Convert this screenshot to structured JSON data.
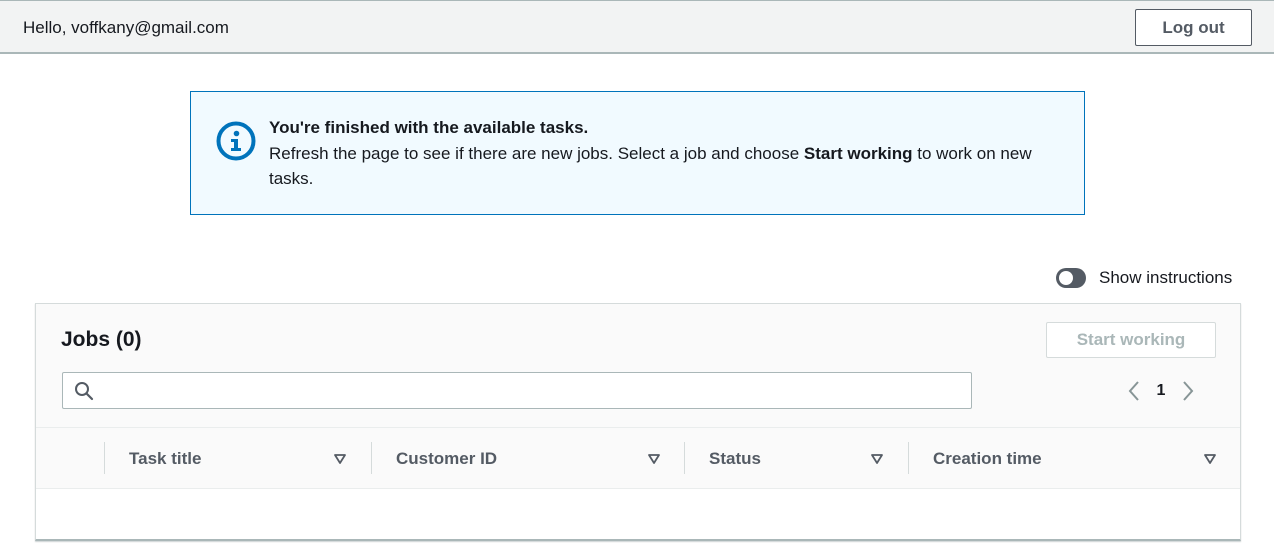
{
  "header": {
    "greeting": "Hello, voffkany@gmail.com",
    "logout_label": "Log out"
  },
  "alert": {
    "icon": "info-icon",
    "title": "You're finished with the available tasks.",
    "body_prefix": "Refresh the page to see if there are new jobs. Select a job and choose ",
    "body_bold": "Start working",
    "body_suffix": " to work on new tasks."
  },
  "instructions_toggle": {
    "label": "Show instructions",
    "on": false
  },
  "jobs": {
    "title": "Jobs (0)",
    "start_label": "Start working",
    "search": {
      "value": "",
      "placeholder": ""
    },
    "pagination": {
      "current_page": "1"
    },
    "columns": [
      "Task title",
      "Customer ID",
      "Status",
      "Creation time"
    ],
    "rows": []
  },
  "colors": {
    "accent": "#0073bb",
    "alert_bg": "#f1faff",
    "text": "#16191f",
    "muted": "#545b64",
    "disabled": "#aab7b8"
  }
}
